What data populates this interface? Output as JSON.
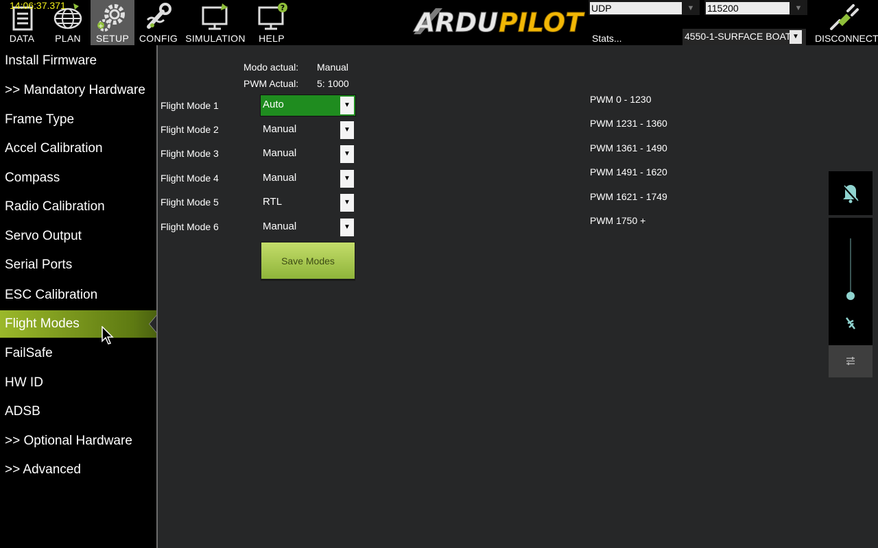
{
  "header": {
    "clock": "14:06:37.371",
    "nav": [
      {
        "label": "DATA",
        "icon": "data-icon"
      },
      {
        "label": "PLAN",
        "icon": "globe-icon"
      },
      {
        "label": "SETUP",
        "icon": "gears-icon"
      },
      {
        "label": "CONFIG",
        "icon": "wrench-icon"
      },
      {
        "label": "SIMULATION",
        "icon": "monitor-plane-icon"
      },
      {
        "label": "HELP",
        "icon": "monitor-help-icon"
      }
    ],
    "logo_text_white": "ARDU",
    "logo_text_yellow": "PILOT",
    "connection_type": "UDP",
    "baud_rate": "115200",
    "stats_link": "Stats...",
    "vehicle": "4550-1-SURFACE BOAT",
    "disconnect_label": "DISCONNECT"
  },
  "sidebar": {
    "items": [
      {
        "label": "Install Firmware"
      },
      {
        "label": ">> Mandatory Hardware"
      },
      {
        "label": "Frame Type"
      },
      {
        "label": "Accel Calibration"
      },
      {
        "label": "Compass"
      },
      {
        "label": "Radio Calibration"
      },
      {
        "label": "Servo Output"
      },
      {
        "label": "Serial Ports"
      },
      {
        "label": "ESC Calibration"
      },
      {
        "label": "Flight Modes",
        "active": true
      },
      {
        "label": "FailSafe"
      },
      {
        "label": "HW ID"
      },
      {
        "label": "ADSB"
      },
      {
        "label": ">> Optional Hardware"
      },
      {
        "label": ">> Advanced"
      }
    ]
  },
  "main": {
    "current_mode_label": "Modo actual:",
    "current_mode_value": "Manual",
    "current_pwm_label": "PWM Actual:",
    "current_pwm_value": "5: 1000",
    "flight_modes": [
      {
        "label": "Flight Mode 1",
        "value": "Auto",
        "pwm": "PWM 0 - 1230",
        "highlight": true
      },
      {
        "label": "Flight Mode 2",
        "value": "Manual",
        "pwm": "PWM 1231 - 1360"
      },
      {
        "label": "Flight Mode 3",
        "value": "Manual",
        "pwm": "PWM 1361 - 1490"
      },
      {
        "label": "Flight Mode 4",
        "value": "Manual",
        "pwm": "PWM 1491 - 1620"
      },
      {
        "label": "Flight Mode 5",
        "value": "RTL",
        "pwm": "PWM 1621 - 1749"
      },
      {
        "label": "Flight Mode 6",
        "value": "Manual",
        "pwm": "PWM 1750 +"
      }
    ],
    "save_button": "Save Modes"
  },
  "colors": {
    "accent_green": "#1f8c1f",
    "clock_yellow": "#f2f01a",
    "logo_yellow": "#f2b705",
    "active_sidebar": "#7a9a1c"
  }
}
